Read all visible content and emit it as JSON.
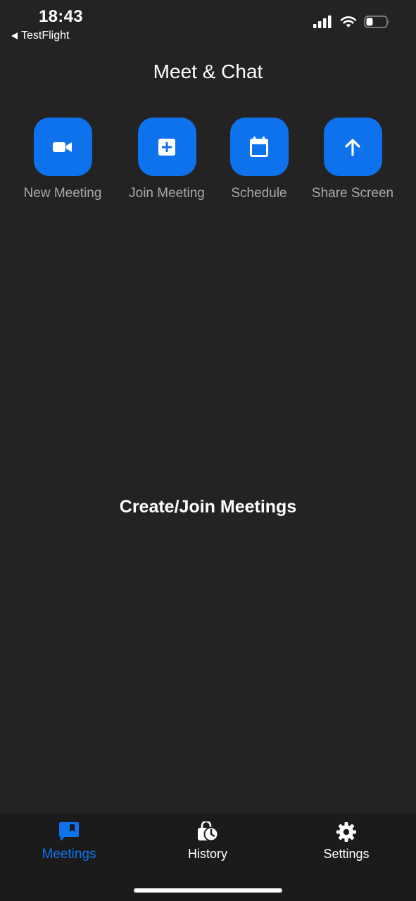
{
  "status_bar": {
    "time": "18:43",
    "back_app": "TestFlight"
  },
  "header": {
    "title": "Meet & Chat"
  },
  "actions": [
    {
      "label": "New Meeting",
      "icon": "video-camera-icon"
    },
    {
      "label": "Join Meeting",
      "icon": "plus-square-icon"
    },
    {
      "label": "Schedule",
      "icon": "calendar-icon"
    },
    {
      "label": "Share Screen",
      "icon": "arrow-up-icon"
    }
  ],
  "main": {
    "empty_message": "Create/Join Meetings"
  },
  "tab_bar": {
    "items": [
      {
        "label": "Meetings",
        "icon": "meetings-icon",
        "active": true
      },
      {
        "label": "History",
        "icon": "history-icon",
        "active": false
      },
      {
        "label": "Settings",
        "icon": "gear-icon",
        "active": false
      }
    ]
  },
  "colors": {
    "background": "#232323",
    "accent": "#0e72ed",
    "tab_bar_background": "#1b1b1b",
    "secondary_text": "#a9a9ad"
  }
}
